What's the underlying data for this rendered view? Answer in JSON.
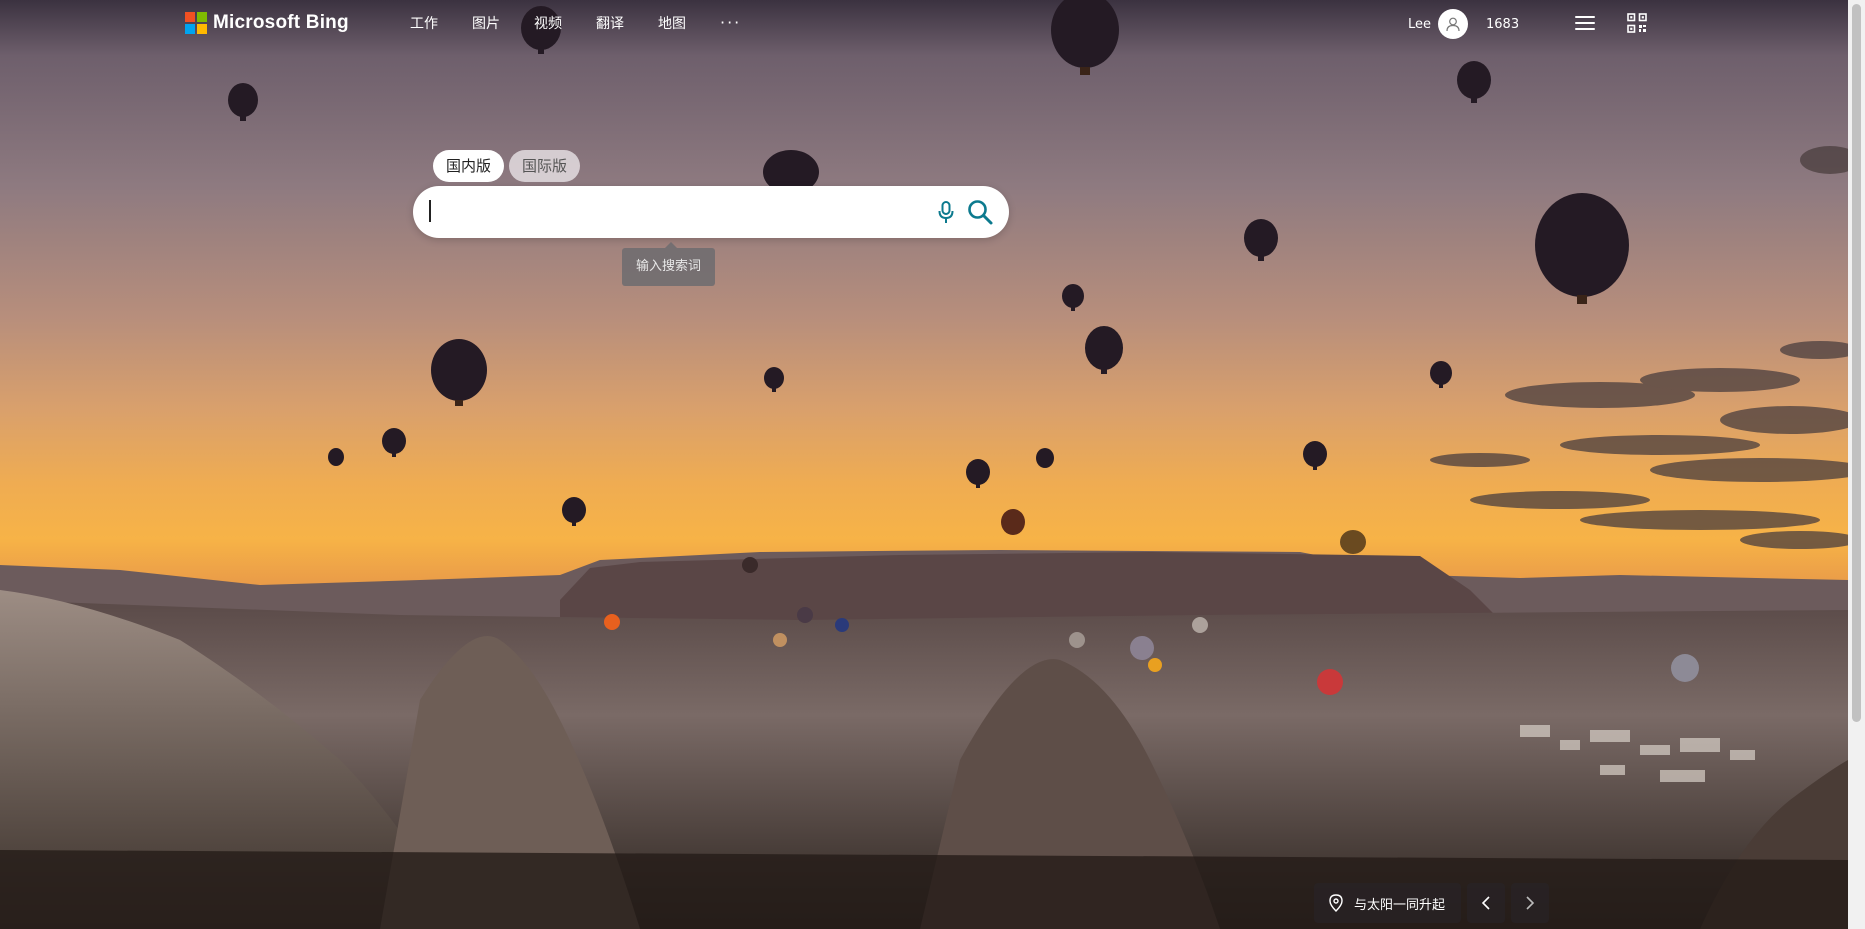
{
  "brand": {
    "logo_text": "Microsoft Bing",
    "logo_colors": [
      "#f25022",
      "#7fba00",
      "#00a4ef",
      "#ffb900"
    ]
  },
  "nav": {
    "items": [
      "工作",
      "图片",
      "视频",
      "翻译",
      "地图"
    ],
    "more": "···"
  },
  "user": {
    "name": "Lee",
    "points": "1683"
  },
  "search": {
    "tabs": [
      {
        "label": "国内版",
        "active": true
      },
      {
        "label": "国际版",
        "active": false
      }
    ],
    "value": "",
    "tooltip": "输入搜索词",
    "accent": "#0c7a8e"
  },
  "image_info": {
    "title": "与太阳一同升起"
  },
  "icons": [
    "user-icon",
    "menu-icon",
    "qr-code-icon",
    "microphone-icon",
    "search-icon",
    "location-pin-icon",
    "chevron-left-icon",
    "chevron-right-icon"
  ]
}
